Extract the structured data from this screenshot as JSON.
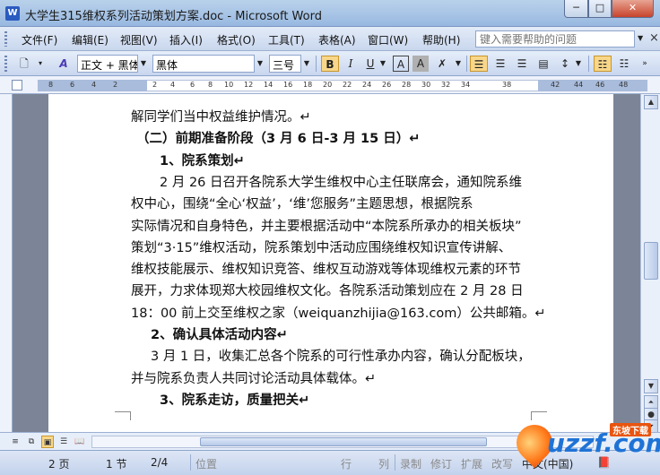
{
  "window": {
    "title": "大学生315维权系列活动策划方案.doc - Microsoft Word",
    "icon_label": "W",
    "min": "─",
    "max": "□",
    "close": "✕"
  },
  "menu": {
    "items": [
      "文件(F)",
      "编辑(E)",
      "视图(V)",
      "插入(I)",
      "格式(O)",
      "工具(T)",
      "表格(A)",
      "窗口(W)",
      "帮助(H)"
    ],
    "help_placeholder": "键入需要帮助的问题",
    "close": "×"
  },
  "toolbar": {
    "style": "正文 + 黑体",
    "font": "黑体",
    "size": "三号",
    "bold": "B",
    "italic": "I",
    "underline": "U",
    "char_border": "A",
    "char_shade": "A",
    "highlight": "A"
  },
  "ruler": {
    "ticks": [
      "8",
      "6",
      "4",
      "2",
      "2",
      "4",
      "6",
      "8",
      "10",
      "12",
      "14",
      "16",
      "18",
      "20",
      "22",
      "24",
      "26",
      "28",
      "30",
      "32",
      "34",
      "38",
      "42",
      "44",
      "46",
      "48"
    ]
  },
  "document": {
    "lines": [
      {
        "text": "解同学们当中权益维护情况。↵",
        "bold": false,
        "indent": 0
      },
      {
        "text": "（二）前期准备阶段（3 月 6 日-3 月 15 日）↵",
        "bold": true,
        "indent": 6
      },
      {
        "text": "1、院系策划↵",
        "bold": true,
        "indent": 32
      },
      {
        "text": "2 月 26 日召开各院系大学生维权中心主任联席会，通知院系维",
        "bold": false,
        "indent": 32
      },
      {
        "text": "权中心，围绕“全心‘权益’，‘维’您服务”主题思想，根据院系",
        "bold": false,
        "indent": 0
      },
      {
        "text": "实际情况和自身特色，并主要根据活动中“本院系所承办的相关板块”",
        "bold": false,
        "indent": 0
      },
      {
        "text": "策划“3·15”维权活动，院系策划中活动应围绕维权知识宣传讲解、",
        "bold": false,
        "indent": 0
      },
      {
        "text": "维权技能展示、维权知识竞答、维权互动游戏等体现维权元素的环节",
        "bold": false,
        "indent": 0
      },
      {
        "text": "展开，力求体现郑大校园维权文化。各院系活动策划应在 2 月 28 日",
        "bold": false,
        "indent": 0
      },
      {
        "text": "18：00 前上交至维权之家（weiquanzhijia@163.com）公共邮箱。↵",
        "bold": false,
        "indent": 0
      },
      {
        "text": "2、确认具体活动内容↵",
        "bold": true,
        "indent": 22
      },
      {
        "text": "3 月 1 日，收集汇总各个院系的可行性承办内容，确认分配板块，",
        "bold": false,
        "indent": 22
      },
      {
        "text": "并与院系负责人共同讨论活动具体载体。↵",
        "bold": false,
        "indent": 0
      },
      {
        "text": "3、院系走访，质量把关↵",
        "bold": true,
        "indent": 32
      }
    ]
  },
  "status": {
    "page": "2 页",
    "section": "1 节",
    "page_of": "2/4",
    "position": "位置",
    "line": "行",
    "col": "列",
    "rec": "录制",
    "trk": "修订",
    "ext": "扩展",
    "ovr": "改写",
    "lang": "中文(中国)"
  },
  "watermark": {
    "text": "uzzf.com",
    "tag": "东坡下载"
  }
}
